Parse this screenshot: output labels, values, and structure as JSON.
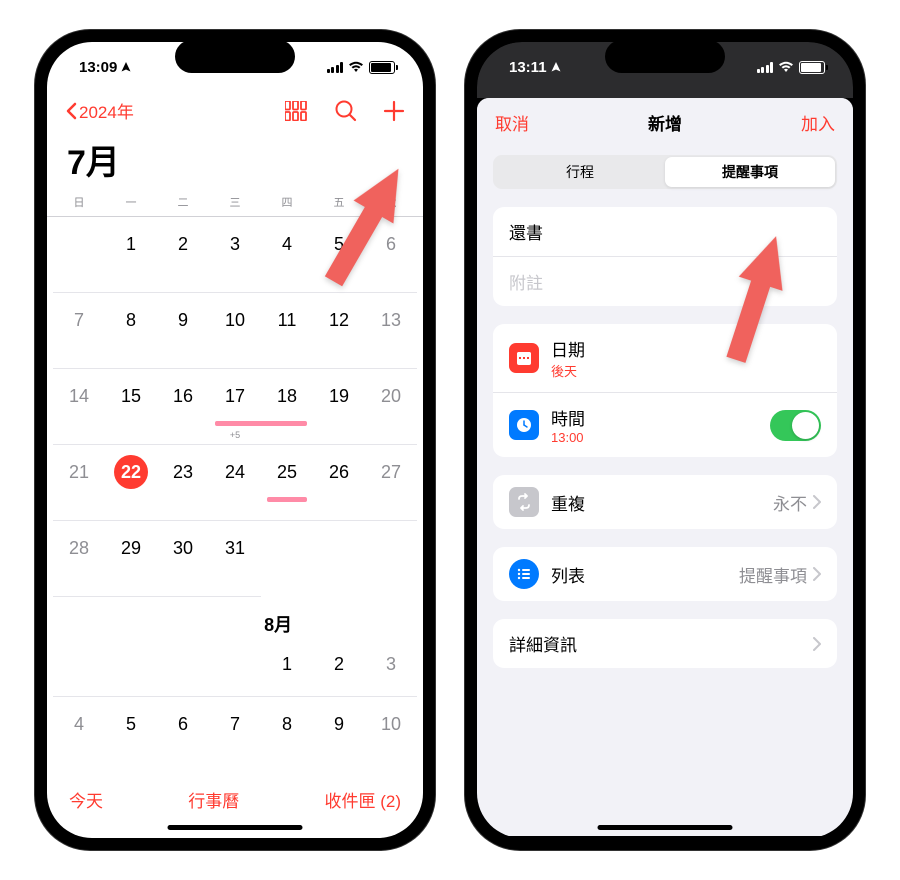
{
  "phone1": {
    "status": {
      "time": "13:09"
    },
    "back_year": "2024年",
    "month_title": "7月",
    "weekdays": [
      "日",
      "一",
      "二",
      "三",
      "四",
      "五",
      "六"
    ],
    "next_month": "8月",
    "more_events": "+5",
    "footer": {
      "today": "今天",
      "calendars": "行事曆",
      "inbox": "收件匣 (2)"
    }
  },
  "phone2": {
    "status": {
      "time": "13:11"
    },
    "header": {
      "cancel": "取消",
      "title": "新增",
      "add": "加入"
    },
    "segments": {
      "event": "行程",
      "reminder": "提醒事項"
    },
    "title_input": "還書",
    "notes_placeholder": "附註",
    "date": {
      "label": "日期",
      "value": "後天"
    },
    "time": {
      "label": "時間",
      "value": "13:00"
    },
    "repeat": {
      "label": "重複",
      "value": "永不"
    },
    "list": {
      "label": "列表",
      "value": "提醒事項"
    },
    "details": {
      "label": "詳細資訊"
    }
  }
}
